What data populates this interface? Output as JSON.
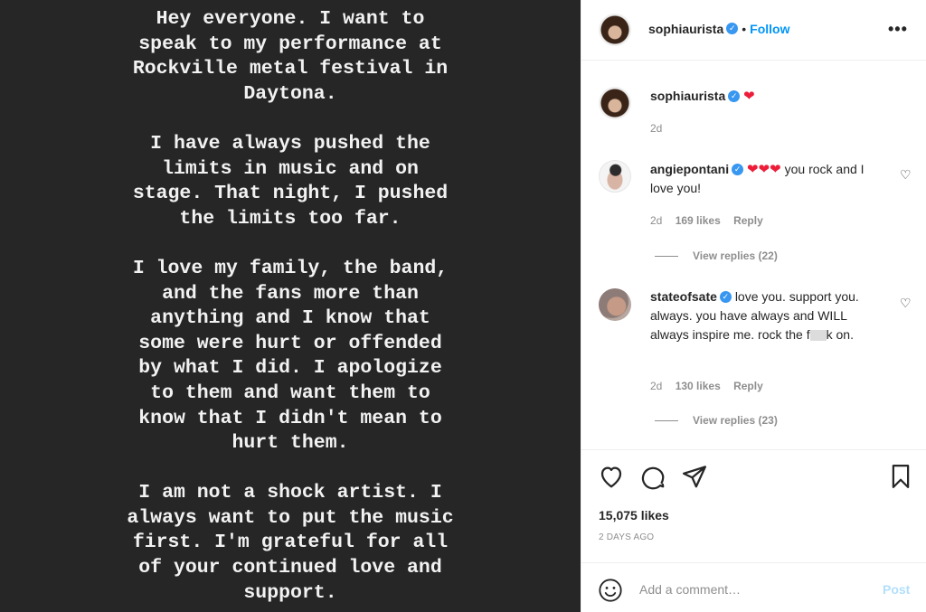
{
  "story": {
    "paragraphs": [
      "Hey everyone. I want to\nspeak to my performance at\nRockville metal festival in\nDaytona.",
      "I have always pushed the\nlimits in music and on\nstage. That night, I pushed\nthe limits too far.",
      "I love my family, the band,\nand the fans more than\nanything and I know that\nsome were hurt or offended\nby what I did. I apologize\nto them and want them to\nknow that I didn't mean to\nhurt them.",
      "I am not a shock artist. I\nalways want to put the music\nfirst. I'm grateful for all\nof your continued love and\nsupport."
    ]
  },
  "header": {
    "username": "sophiaurista",
    "verified_icon": "verified-badge-icon",
    "separator": "•",
    "follow_label": "Follow",
    "more_icon": "•••"
  },
  "caption": {
    "username": "sophiaurista",
    "emoji": "❤",
    "time": "2d"
  },
  "comments": [
    {
      "username": "angiepontani",
      "emoji": "❤❤❤",
      "text": "you rock and I love you!",
      "time": "2d",
      "likes": "169 likes",
      "reply_label": "Reply",
      "view_replies": "View replies (22)"
    },
    {
      "username": "stateofsate",
      "text_before": "love you. support you. always. you have always and WILL always inspire me. rock the f",
      "text_after": "k on.",
      "time": "2d",
      "likes": "130 likes",
      "reply_label": "Reply",
      "view_replies": "View replies (23)"
    }
  ],
  "actions": {
    "likes": "15,075 likes",
    "posted_ago": "2 DAYS AGO"
  },
  "comment_box": {
    "placeholder": "Add a comment…",
    "post_label": "Post"
  },
  "colors": {
    "image_bg": "#262626",
    "accent": "#0095f6",
    "verified": "#3897f0",
    "heart": "#ed1d3a"
  }
}
